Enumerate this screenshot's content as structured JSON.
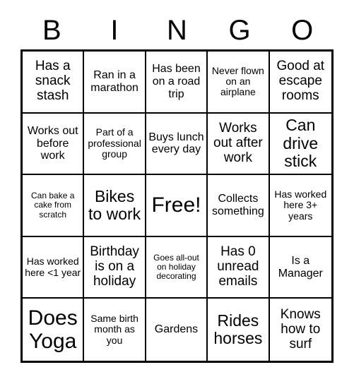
{
  "card": {
    "title": "Bingo",
    "header_letters": [
      "B",
      "I",
      "N",
      "G",
      "O"
    ],
    "border_color": "#000000",
    "background_color": "#ffffff",
    "text_color": "#000000",
    "rows": 5,
    "columns": 5,
    "cells": [
      {
        "text": "Has a snack stash",
        "size": "lg",
        "free": false,
        "marked": false
      },
      {
        "text": "Ran in a marathon",
        "size": "md",
        "free": false,
        "marked": false
      },
      {
        "text": "Has been on a road trip",
        "size": "md",
        "free": false,
        "marked": false
      },
      {
        "text": "Never flown on an airplane",
        "size": "sm",
        "free": false,
        "marked": false
      },
      {
        "text": "Good at escape rooms",
        "size": "lg",
        "free": false,
        "marked": false
      },
      {
        "text": "Works out before work",
        "size": "md",
        "free": false,
        "marked": false
      },
      {
        "text": "Part of a professional group",
        "size": "sm",
        "free": false,
        "marked": false
      },
      {
        "text": "Buys lunch every day",
        "size": "md",
        "free": false,
        "marked": false
      },
      {
        "text": "Works out after work",
        "size": "lg",
        "free": false,
        "marked": false
      },
      {
        "text": "Can drive stick",
        "size": "xl",
        "free": false,
        "marked": false
      },
      {
        "text": "Can bake a cake from scratch",
        "size": "xs",
        "free": false,
        "marked": false
      },
      {
        "text": "Bikes to work",
        "size": "xl",
        "free": false,
        "marked": false
      },
      {
        "text": "Free!",
        "size": "xxl",
        "free": true,
        "marked": false
      },
      {
        "text": "Collects something",
        "size": "md",
        "free": false,
        "marked": false
      },
      {
        "text": "Has worked here 3+ years",
        "size": "sm",
        "free": false,
        "marked": false
      },
      {
        "text": "Has worked here <1 year",
        "size": "sm",
        "free": false,
        "marked": false
      },
      {
        "text": "Birthday is on a holiday",
        "size": "lg",
        "free": false,
        "marked": false
      },
      {
        "text": "Goes all-out on holiday decorating",
        "size": "xs",
        "free": false,
        "marked": false
      },
      {
        "text": "Has 0 unread emails",
        "size": "lg",
        "free": false,
        "marked": false
      },
      {
        "text": "Is a Manager",
        "size": "md",
        "free": false,
        "marked": false
      },
      {
        "text": "Does Yoga",
        "size": "xxl",
        "free": false,
        "marked": false
      },
      {
        "text": "Same birth month as you",
        "size": "sm",
        "free": false,
        "marked": false
      },
      {
        "text": "Gardens",
        "size": "md",
        "free": false,
        "marked": false
      },
      {
        "text": "Rides horses",
        "size": "xl",
        "free": false,
        "marked": false
      },
      {
        "text": "Knows how to surf",
        "size": "lg",
        "free": false,
        "marked": false
      }
    ]
  }
}
